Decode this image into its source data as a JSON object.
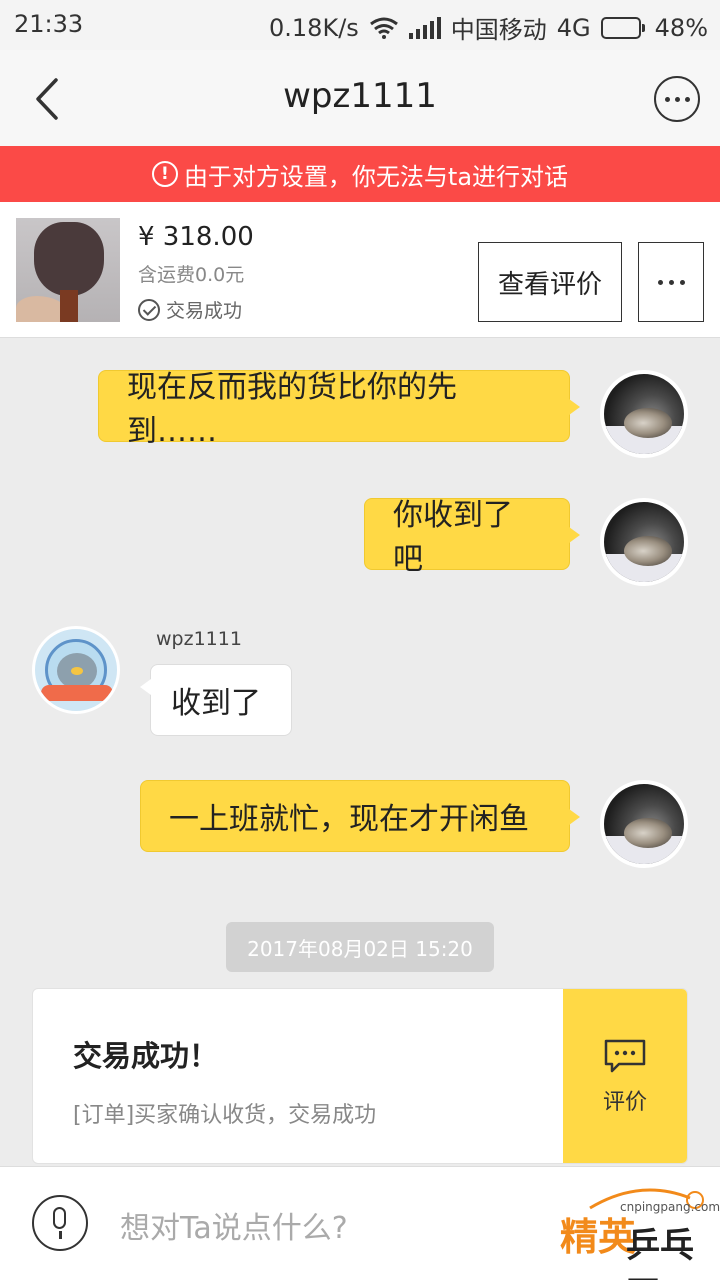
{
  "status_bar": {
    "time": "21:33",
    "net_speed": "0.18K/s",
    "carrier": "中国移动",
    "network": "4G",
    "battery": "48%",
    "battery_level": 0.48
  },
  "header": {
    "title": "wpz1111"
  },
  "banner": {
    "icon": "!",
    "text": "由于对方设置，你无法与ta进行对话"
  },
  "item": {
    "price": "¥ 318.00",
    "shipping": "含运费0.0元",
    "status": "交易成功",
    "review_button": "查看评价"
  },
  "messages": [
    {
      "from": "me",
      "text": "现在反而我的货比你的先到……"
    },
    {
      "from": "me",
      "text": "你收到了吧"
    },
    {
      "from": "other",
      "sender": "wpz1111",
      "text": "收到了"
    },
    {
      "from": "me",
      "text": "一上班就忙，现在才开闲鱼"
    }
  ],
  "timestamp": "2017年08月02日 15:20",
  "order_card": {
    "title": "交易成功！",
    "description": "[订单]买家确认收货，交易成功",
    "rate_label": "评价"
  },
  "input": {
    "placeholder": "想对Ta说点什么?"
  },
  "watermark": {
    "url": "cnpingpang.com",
    "text1": "精英",
    "text2": "乒乓网"
  },
  "colors": {
    "banner": "#fb4a47",
    "bubble_me": "#ffd945",
    "accent": "#ffd945"
  }
}
